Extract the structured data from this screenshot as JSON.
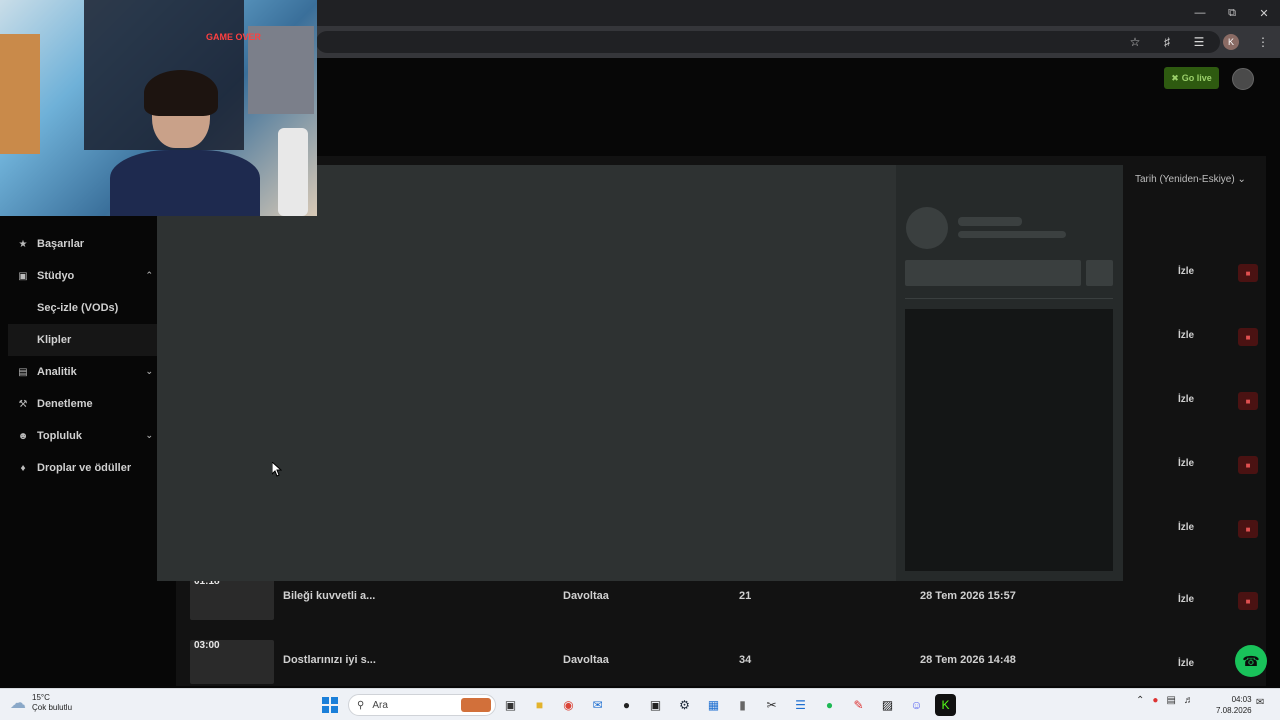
{
  "browser": {
    "profile_initial": "K"
  },
  "header": {
    "go_live_label": "Go live"
  },
  "sort": {
    "label": "Tarih (Yeniden-Eskiye)"
  },
  "sidebar": {
    "items": [
      {
        "label": "Başarılar",
        "icon": "trophy-icon"
      },
      {
        "label": "Stüdyo",
        "icon": "studio-icon",
        "expanded": true
      },
      {
        "label": "Seç-izle (VODs)",
        "sub": true
      },
      {
        "label": "Klipler",
        "sub": true,
        "active": true
      },
      {
        "label": "Analitik",
        "icon": "chart-icon",
        "expanded": false
      },
      {
        "label": "Denetleme",
        "icon": "wrench-icon"
      },
      {
        "label": "Topluluk",
        "icon": "community-icon",
        "expanded": false
      },
      {
        "label": "Droplar ve ödüller",
        "icon": "drops-icon"
      }
    ]
  },
  "table": {
    "action_label": "İzle",
    "rows": [
      {
        "time": "01:18",
        "title": "Bileği kuvvetli a...",
        "author": "Davoltaa",
        "views": "21",
        "date": "28 Tem 2026 15:57"
      },
      {
        "time": "03:00",
        "title": "Dostlarınızı iyi s...",
        "author": "Davoltaa",
        "views": "34",
        "date": "28 Tem 2026 14:48"
      }
    ]
  },
  "webcam": {
    "poster_text": "GAME OVER"
  },
  "taskbar": {
    "weather_temp": "15°C",
    "weather_desc": "Çok bulutlu",
    "search_placeholder": "Ara",
    "time": "04:03",
    "date": "7.08.2026"
  },
  "colors": {
    "go_live_bg": "#2e5a10",
    "help_button": "#19c25a",
    "delete_button": "#4a1212",
    "modal_bg": "#2e3232"
  }
}
